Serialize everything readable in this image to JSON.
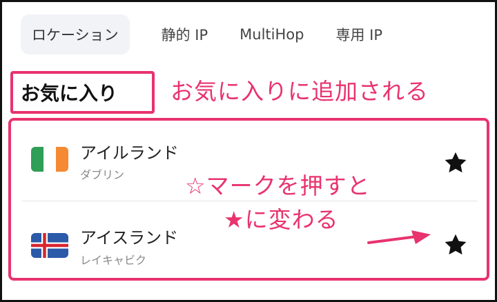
{
  "tabs": [
    {
      "label": "ロケーション",
      "active": true
    },
    {
      "label": "静的 IP",
      "active": false
    },
    {
      "label": "MultiHop",
      "active": false
    },
    {
      "label": "専用 IP",
      "active": false
    }
  ],
  "favorites": {
    "title": "お気に入り",
    "note": "お気に入りに追加される"
  },
  "locations": [
    {
      "country": "アイルランド",
      "city": "ダブリン",
      "flag": "ireland-flag",
      "favorited": true
    },
    {
      "country": "アイスランド",
      "city": "レイキャビク",
      "flag": "iceland-flag",
      "favorited": true
    }
  ],
  "annotation": {
    "line1": "☆マークを押すと",
    "line2": "★に変わる"
  },
  "colors": {
    "accent": "#e8336e",
    "tab_active_bg": "#f1f3f7"
  }
}
